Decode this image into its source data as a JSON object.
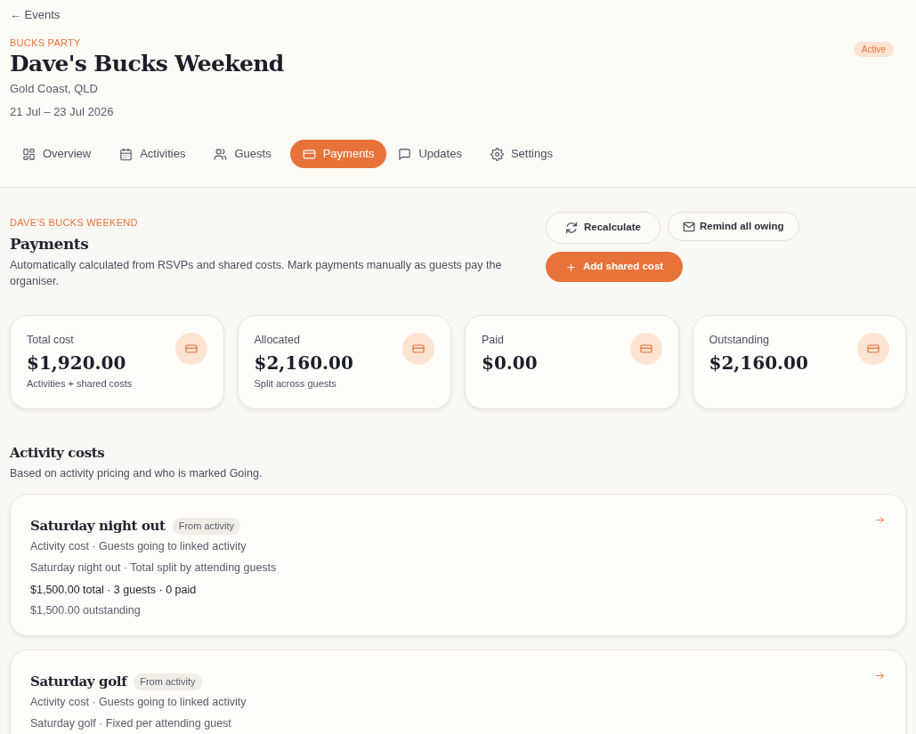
{
  "back_link": "← Events",
  "event": {
    "category": "BUCKS PARTY",
    "title": "Dave's Bucks Weekend",
    "location": "Gold Coast, QLD",
    "dates": "21 Jul – 23 Jul 2026",
    "status": "Active"
  },
  "tabs": [
    {
      "label": "Overview",
      "selected": false
    },
    {
      "label": "Activities",
      "selected": false
    },
    {
      "label": "Guests",
      "selected": false
    },
    {
      "label": "Payments",
      "selected": true
    },
    {
      "label": "Updates",
      "selected": false
    },
    {
      "label": "Settings",
      "selected": false
    }
  ],
  "section": {
    "eyebrow": "DAVE'S BUCKS WEEKEND",
    "title": "Payments",
    "description": "Automatically calculated from RSVPs and shared costs. Mark payments manually as guests pay the organiser."
  },
  "actions": {
    "recalculate": "Recalculate",
    "remind": "Remind all owing",
    "add": "Add shared cost"
  },
  "stats": [
    {
      "label": "Total cost",
      "value": "$1,920.00",
      "note": "Activities + shared costs"
    },
    {
      "label": "Allocated",
      "value": "$2,160.00",
      "note": "Split across guests"
    },
    {
      "label": "Paid",
      "value": "$0.00"
    },
    {
      "label": "Outstanding",
      "value": "$2,160.00"
    }
  ],
  "activity_costs": {
    "title": "Activity costs",
    "subtitle": "Based on activity pricing and who is marked Going.",
    "items": [
      {
        "name": "Saturday night out",
        "tag": "From activity",
        "type_line": "Activity cost · Guests going to linked activity",
        "split_line": "Saturday night out · Total split by attending guests",
        "summary": "$1,500.00 total · 3 guests · 0 paid",
        "outstanding": "$1,500.00 outstanding"
      },
      {
        "name": "Saturday golf",
        "tag": "From activity",
        "type_line": "Activity cost · Guests going to linked activity",
        "split_line": "Saturday golf · Fixed per attending guest"
      }
    ]
  }
}
